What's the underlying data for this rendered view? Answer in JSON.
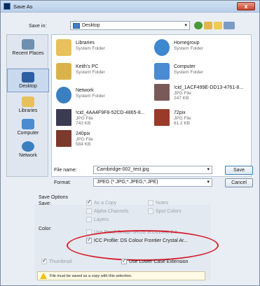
{
  "window": {
    "title": "Save As"
  },
  "savein": {
    "label": "Save in:",
    "value": "Desktop"
  },
  "places": [
    {
      "label": "Recent Places",
      "icon": "recent-places-icon",
      "color": "#6f8fb0"
    },
    {
      "label": "Desktop",
      "icon": "desktop-icon",
      "color": "#2e5fa3"
    },
    {
      "label": "Libraries",
      "icon": "libraries-icon",
      "color": "#e8c15c"
    },
    {
      "label": "Computer",
      "icon": "computer-icon",
      "color": "#4a8bd1"
    },
    {
      "label": "Network",
      "icon": "network-icon",
      "color": "#3a7fc0"
    }
  ],
  "files": [
    {
      "name": "Libraries",
      "type": "System Folder",
      "size": "",
      "color": "#e8c15c"
    },
    {
      "name": "Homegroup",
      "type": "System Folder",
      "size": "",
      "color": "#3d88cf"
    },
    {
      "name": "Keith's PC",
      "type": "System Folder",
      "size": "",
      "color": "#d9b34a"
    },
    {
      "name": "Computer",
      "type": "System Folder",
      "size": "",
      "color": "#4a8bd1"
    },
    {
      "name": "Network",
      "type": "System Folder",
      "size": "",
      "color": "#3a7fc0"
    },
    {
      "name": "!cid_1ACF499E-DD13-4761-8...",
      "type": "JPG File",
      "size": "247 KB",
      "color": "#7a5a58"
    },
    {
      "name": "!cid_4AA4F9F8-52CD-4865-8...",
      "type": "JPG File",
      "size": "743 KB",
      "color": "#3b3b52"
    },
    {
      "name": "72pix",
      "type": "JPG File",
      "size": "81.2 KB",
      "color": "#9a3a2a"
    },
    {
      "name": "240pix",
      "type": "JPG File",
      "size": "584 KB",
      "color": "#7c3a2c"
    }
  ],
  "form": {
    "filename_label": "File name:",
    "filename_value": "Cambridge-002_test.jpg",
    "format_label": "Format:",
    "format_value": "JPEG (*.JPG;*.JPEG;*.JPE)",
    "save_label": "Save",
    "cancel_label": "Cancel"
  },
  "options": {
    "heading": "Save Options",
    "save_label": "Save:",
    "as_copy": "As a Copy",
    "notes": "Notes",
    "alpha": "Alpha Channels",
    "spot": "Spot Colors",
    "layers": "Layers",
    "color_label": "Color:",
    "proof": "Use Proof Setup:  sRGB IEC61966-2.1",
    "icc": "ICC Profile:  DS Colour  Frontier Crystal Ar...",
    "thumbnail": "Thumbnail",
    "lowercase": "Use Lower Case Extension",
    "warning": "File must be saved as a copy with this selection."
  }
}
